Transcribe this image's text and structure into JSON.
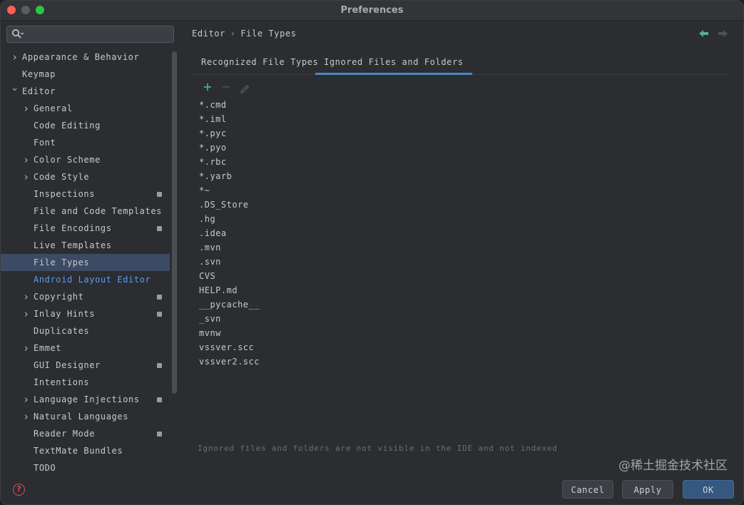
{
  "window": {
    "title": "Preferences"
  },
  "search": {
    "placeholder": "",
    "value": ""
  },
  "sidebar": {
    "items": [
      {
        "label": "Appearance & Behavior",
        "level": 0,
        "expandable": true,
        "expanded": false,
        "badge": false
      },
      {
        "label": "Keymap",
        "level": 0,
        "expandable": false,
        "badge": false
      },
      {
        "label": "Editor",
        "level": 0,
        "expandable": true,
        "expanded": true,
        "badge": false
      },
      {
        "label": "General",
        "level": 1,
        "expandable": true,
        "expanded": false,
        "badge": false
      },
      {
        "label": "Code Editing",
        "level": 1,
        "expandable": false,
        "badge": false
      },
      {
        "label": "Font",
        "level": 1,
        "expandable": false,
        "badge": false
      },
      {
        "label": "Color Scheme",
        "level": 1,
        "expandable": true,
        "expanded": false,
        "badge": false
      },
      {
        "label": "Code Style",
        "level": 1,
        "expandable": true,
        "expanded": false,
        "badge": false
      },
      {
        "label": "Inspections",
        "level": 1,
        "expandable": false,
        "badge": true
      },
      {
        "label": "File and Code Templates",
        "level": 1,
        "expandable": false,
        "badge": false
      },
      {
        "label": "File Encodings",
        "level": 1,
        "expandable": false,
        "badge": true
      },
      {
        "label": "Live Templates",
        "level": 1,
        "expandable": false,
        "badge": false
      },
      {
        "label": "File Types",
        "level": 1,
        "expandable": false,
        "badge": false,
        "selected": true
      },
      {
        "label": "Android Layout Editor",
        "level": 1,
        "expandable": false,
        "badge": false,
        "link": true
      },
      {
        "label": "Copyright",
        "level": 1,
        "expandable": true,
        "expanded": false,
        "badge": true
      },
      {
        "label": "Inlay Hints",
        "level": 1,
        "expandable": true,
        "expanded": false,
        "badge": true
      },
      {
        "label": "Duplicates",
        "level": 1,
        "expandable": false,
        "badge": false
      },
      {
        "label": "Emmet",
        "level": 1,
        "expandable": true,
        "expanded": false,
        "badge": false
      },
      {
        "label": "GUI Designer",
        "level": 1,
        "expandable": false,
        "badge": true
      },
      {
        "label": "Intentions",
        "level": 1,
        "expandable": false,
        "badge": false
      },
      {
        "label": "Language Injections",
        "level": 1,
        "expandable": true,
        "expanded": false,
        "badge": true
      },
      {
        "label": "Natural Languages",
        "level": 1,
        "expandable": true,
        "expanded": false,
        "badge": false
      },
      {
        "label": "Reader Mode",
        "level": 1,
        "expandable": false,
        "badge": true
      },
      {
        "label": "TextMate Bundles",
        "level": 1,
        "expandable": false,
        "badge": false
      },
      {
        "label": "TODO",
        "level": 1,
        "expandable": false,
        "badge": false
      }
    ]
  },
  "breadcrumb": {
    "parent": "Editor",
    "separator": "›",
    "current": "File Types"
  },
  "tabs": [
    {
      "label": "Recognized File Types",
      "active": false
    },
    {
      "label": "Ignored Files and Folders",
      "active": true
    }
  ],
  "toolbar": {
    "add_icon": "+",
    "remove_icon": "−"
  },
  "ignored_items": [
    "*.cmd",
    "*.iml",
    "*.pyc",
    "*.pyo",
    "*.rbc",
    "*.yarb",
    "*~",
    ".DS_Store",
    ".hg",
    ".idea",
    ".mvn",
    ".svn",
    "CVS",
    "HELP.md",
    "__pycache__",
    "_svn",
    "mvnw",
    "vssver.scc",
    "vssver2.scc"
  ],
  "note": "Ignored files and folders are not visible in the IDE and not indexed",
  "buttons": {
    "cancel": "Cancel",
    "apply": "Apply",
    "ok": "OK"
  },
  "help": {
    "icon": "?"
  },
  "watermark": "@稀土掘金技术社区",
  "colors": {
    "selection": "#3d4a63",
    "link": "#589df6",
    "tab_underline": "#4a88c7",
    "add_icon": "#3fa98e",
    "ok_button": "#365880"
  }
}
